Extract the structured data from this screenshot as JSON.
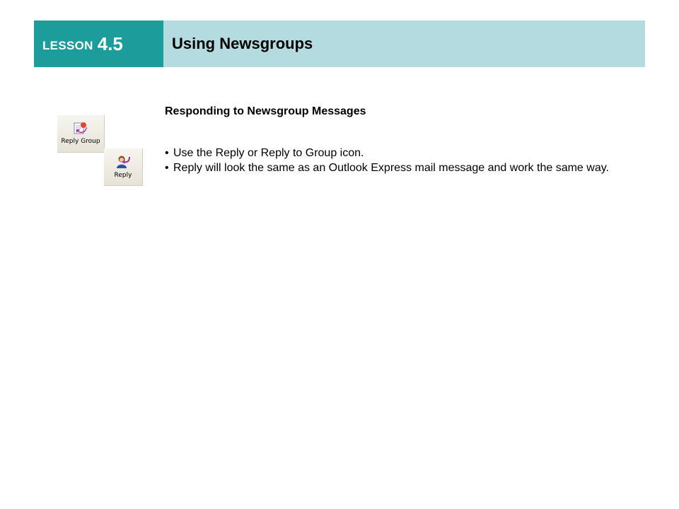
{
  "header": {
    "lesson_word": "LESSON",
    "lesson_number": "4.5",
    "title": "Using Newsgroups"
  },
  "content": {
    "subheading": "Responding to Newsgroup Messages",
    "bullets": [
      "Use the Reply or Reply to Group icon.",
      "Reply will look the same as an Outlook Express mail message and work the same way."
    ]
  },
  "toolbar": {
    "reply_group_label": "Reply Group",
    "reply_label": "Reply",
    "reply_group_icon": "reply-group-icon",
    "reply_icon": "reply-icon"
  },
  "colors": {
    "lesson_bg": "#1d9c9c",
    "title_bg": "#b3dbe0"
  }
}
